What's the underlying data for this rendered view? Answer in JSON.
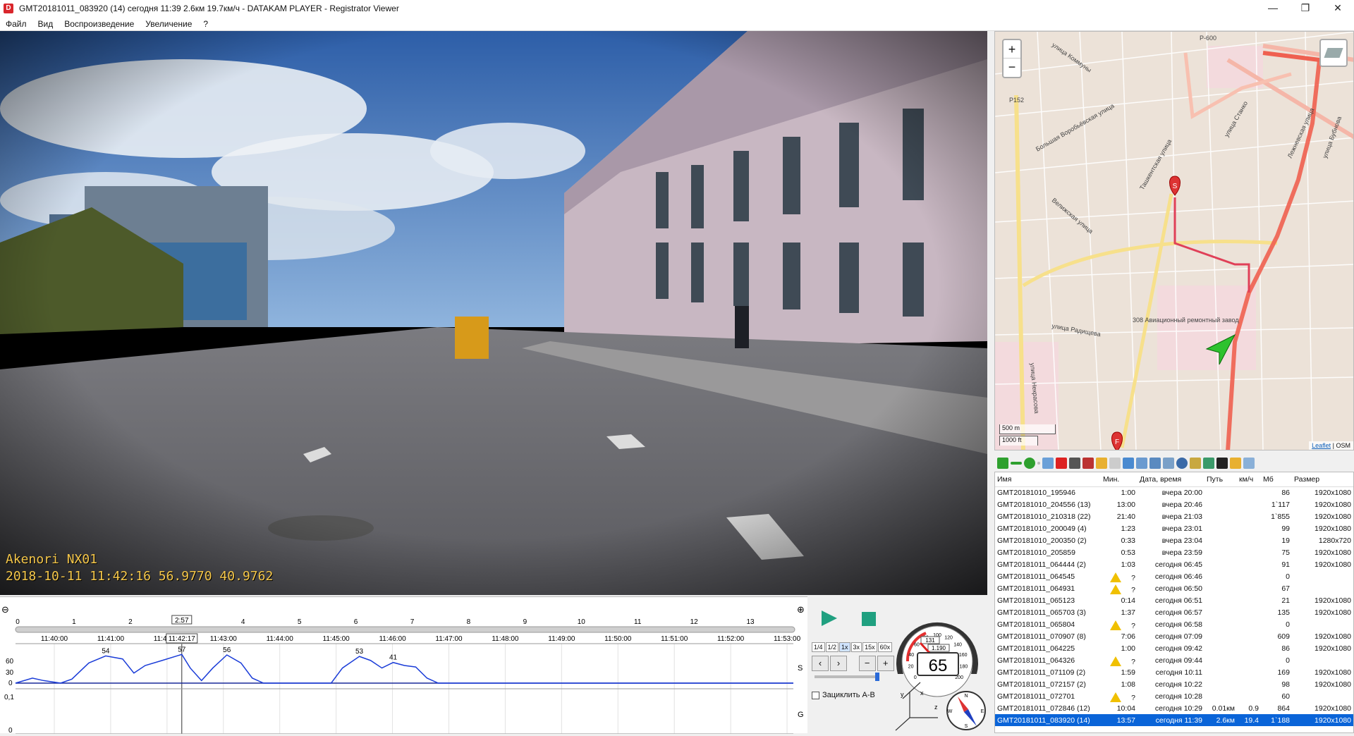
{
  "window": {
    "title": "GMT20181011_083920 (14)   сегодня 11:39   2.6км   19.7км/ч  -  DATAKAM PLAYER - Registrator Viewer",
    "minimize": "—",
    "maximize": "❐",
    "close": "✕"
  },
  "menu": [
    "Файл",
    "Вид",
    "Воспроизведение",
    "Увеличение",
    "?"
  ],
  "video": {
    "overlay_line1": "Akenori NX01",
    "overlay_line2": "2018-10-11 11:42:16 56.9770 40.9762"
  },
  "timeline": {
    "minute_ticks": [
      "0",
      "1",
      "2",
      "3",
      "4",
      "5",
      "6",
      "7",
      "8",
      "9",
      "10",
      "11",
      "12",
      "13"
    ],
    "cursor_minute": "2:57",
    "time_labels": [
      "11:40:00",
      "11:41:00",
      "11:42:00",
      "11:43:00",
      "11:44:00",
      "11:45:00",
      "11:46:00",
      "11:47:00",
      "11:48:00",
      "11:49:00",
      "11:50:00",
      "11:51:00",
      "11:52:00",
      "11:53:00"
    ],
    "cursor_time": "11:42:17",
    "zoom_out": "⊖",
    "zoom_in": "⊕",
    "chart_s_label": "S",
    "chart_g_label": "G",
    "y_speed_60": "60",
    "y_speed_30": "30",
    "y_speed_0": "0",
    "y_g_01": "0,1",
    "y_g_0": "0"
  },
  "chart_data": {
    "type": "line",
    "x_unit": "minutes",
    "ylabel": "",
    "ylim": [
      0,
      70
    ],
    "peak_labels": [
      {
        "x": 1.6,
        "value": "54"
      },
      {
        "x": 2.95,
        "value": "57"
      },
      {
        "x": 3.75,
        "value": "56"
      },
      {
        "x": 6.1,
        "value": "53"
      },
      {
        "x": 6.7,
        "value": "41"
      }
    ],
    "series": [
      {
        "name": "S",
        "points": [
          [
            0,
            0
          ],
          [
            0.3,
            10
          ],
          [
            0.5,
            5
          ],
          [
            0.8,
            0
          ],
          [
            1.0,
            8
          ],
          [
            1.3,
            40
          ],
          [
            1.6,
            54
          ],
          [
            1.9,
            48
          ],
          [
            2.1,
            20
          ],
          [
            2.3,
            35
          ],
          [
            2.6,
            45
          ],
          [
            2.95,
            57
          ],
          [
            3.1,
            30
          ],
          [
            3.3,
            5
          ],
          [
            3.5,
            30
          ],
          [
            3.75,
            56
          ],
          [
            4.0,
            40
          ],
          [
            4.2,
            10
          ],
          [
            4.4,
            0
          ],
          [
            5.6,
            0
          ],
          [
            5.8,
            30
          ],
          [
            6.1,
            53
          ],
          [
            6.3,
            45
          ],
          [
            6.5,
            30
          ],
          [
            6.7,
            41
          ],
          [
            6.9,
            35
          ],
          [
            7.1,
            32
          ],
          [
            7.3,
            10
          ],
          [
            7.5,
            0
          ],
          [
            13.8,
            0
          ]
        ]
      }
    ]
  },
  "controls": {
    "speeds": [
      "1/4",
      "1/2",
      "1x",
      "3x",
      "15x",
      "60x"
    ],
    "active_speed": "1x",
    "loop_label": "Зациклить A-B",
    "speedometer_value": "65",
    "odometer": "131",
    "trip": "1.190",
    "dial_labels": [
      "0",
      "20",
      "40",
      "60",
      "80",
      "100",
      "120",
      "140",
      "160",
      "180",
      "200"
    ],
    "compass_n": "N",
    "compass_e": "E",
    "compass_s": "S",
    "compass_w": "W",
    "axis_x": "x",
    "axis_y": "y",
    "axis_z": "z"
  },
  "map": {
    "zoom_in": "+",
    "zoom_out": "−",
    "scale_m": "500 m",
    "scale_ft": "1000 ft",
    "attribution_leaflet": "Leaflet",
    "attribution_osm": "OSM",
    "road_labels": [
      "Р-600",
      "Р152",
      "улица Коммуны",
      "Большая Воробьёвская улица",
      "Велижская улица",
      "Ташкентская улица",
      "Лежневская улица",
      "улица Бубнова",
      "улица Радищева",
      "улица Некрасова",
      "улица Станко",
      "308 Авиационный ремонтный завод"
    ],
    "marker_start": "S",
    "marker_finish": "F"
  },
  "files": {
    "headers": [
      "Имя",
      "Мин.",
      "Дата, время",
      "Путь",
      "км/ч",
      "Мб",
      "Размер"
    ],
    "rows": [
      {
        "name": "GMT20181010_195946",
        "min": "1:00",
        "dt": "вчера 20:00",
        "path": "",
        "kmh": "",
        "mb": "86",
        "size": "1920x1080",
        "warn": false
      },
      {
        "name": "GMT20181010_204556 (13)",
        "min": "13:00",
        "dt": "вчера 20:46",
        "path": "",
        "kmh": "",
        "mb": "1`117",
        "size": "1920x1080",
        "warn": false
      },
      {
        "name": "GMT20181010_210318 (22)",
        "min": "21:40",
        "dt": "вчера 21:03",
        "path": "",
        "kmh": "",
        "mb": "1`855",
        "size": "1920x1080",
        "warn": false
      },
      {
        "name": "GMT20181010_200049 (4)",
        "min": "1:23",
        "dt": "вчера 23:01",
        "path": "",
        "kmh": "",
        "mb": "99",
        "size": "1920x1080",
        "warn": false
      },
      {
        "name": "GMT20181010_200350 (2)",
        "min": "0:33",
        "dt": "вчера 23:04",
        "path": "",
        "kmh": "",
        "mb": "19",
        "size": "1280x720",
        "warn": false
      },
      {
        "name": "GMT20181010_205859",
        "min": "0:53",
        "dt": "вчера 23:59",
        "path": "",
        "kmh": "",
        "mb": "75",
        "size": "1920x1080",
        "warn": false
      },
      {
        "name": "GMT20181011_064444 (2)",
        "min": "1:03",
        "dt": "сегодня 06:45",
        "path": "",
        "kmh": "",
        "mb": "91",
        "size": "1920x1080",
        "warn": false
      },
      {
        "name": "GMT20181011_064545",
        "min": "?",
        "dt": "сегодня 06:46",
        "path": "",
        "kmh": "",
        "mb": "0",
        "size": "",
        "warn": true
      },
      {
        "name": "GMT20181011_064931",
        "min": "?",
        "dt": "сегодня 06:50",
        "path": "",
        "kmh": "",
        "mb": "67",
        "size": "",
        "warn": true
      },
      {
        "name": "GMT20181011_065123",
        "min": "0:14",
        "dt": "сегодня 06:51",
        "path": "",
        "kmh": "",
        "mb": "21",
        "size": "1920x1080",
        "warn": false
      },
      {
        "name": "GMT20181011_065703 (3)",
        "min": "1:37",
        "dt": "сегодня 06:57",
        "path": "",
        "kmh": "",
        "mb": "135",
        "size": "1920x1080",
        "warn": false
      },
      {
        "name": "GMT20181011_065804",
        "min": "?",
        "dt": "сегодня 06:58",
        "path": "",
        "kmh": "",
        "mb": "0",
        "size": "",
        "warn": true
      },
      {
        "name": "GMT20181011_070907 (8)",
        "min": "7:06",
        "dt": "сегодня 07:09",
        "path": "",
        "kmh": "",
        "mb": "609",
        "size": "1920x1080",
        "warn": false
      },
      {
        "name": "GMT20181011_064225",
        "min": "1:00",
        "dt": "сегодня 09:42",
        "path": "",
        "kmh": "",
        "mb": "86",
        "size": "1920x1080",
        "warn": false
      },
      {
        "name": "GMT20181011_064326",
        "min": "?",
        "dt": "сегодня 09:44",
        "path": "",
        "kmh": "",
        "mb": "0",
        "size": "",
        "warn": true
      },
      {
        "name": "GMT20181011_071109 (2)",
        "min": "1:59",
        "dt": "сегодня 10:11",
        "path": "",
        "kmh": "",
        "mb": "169",
        "size": "1920x1080",
        "warn": false
      },
      {
        "name": "GMT20181011_072157 (2)",
        "min": "1:08",
        "dt": "сегодня 10:22",
        "path": "",
        "kmh": "",
        "mb": "98",
        "size": "1920x1080",
        "warn": false
      },
      {
        "name": "GMT20181011_072701",
        "min": "?",
        "dt": "сегодня 10:28",
        "path": "",
        "kmh": "",
        "mb": "60",
        "size": "",
        "warn": true
      },
      {
        "name": "GMT20181011_072846 (12)",
        "min": "10:04",
        "dt": "сегодня 10:29",
        "path": "0.01км",
        "kmh": "0.9",
        "mb": "864",
        "size": "1920x1080",
        "warn": false
      },
      {
        "name": "GMT20181011_083920 (14)",
        "min": "13:57",
        "dt": "сегодня 11:39",
        "path": "2.6км",
        "kmh": "19.4",
        "mb": "1`188",
        "size": "1920x1080",
        "warn": false,
        "selected": true
      }
    ]
  }
}
